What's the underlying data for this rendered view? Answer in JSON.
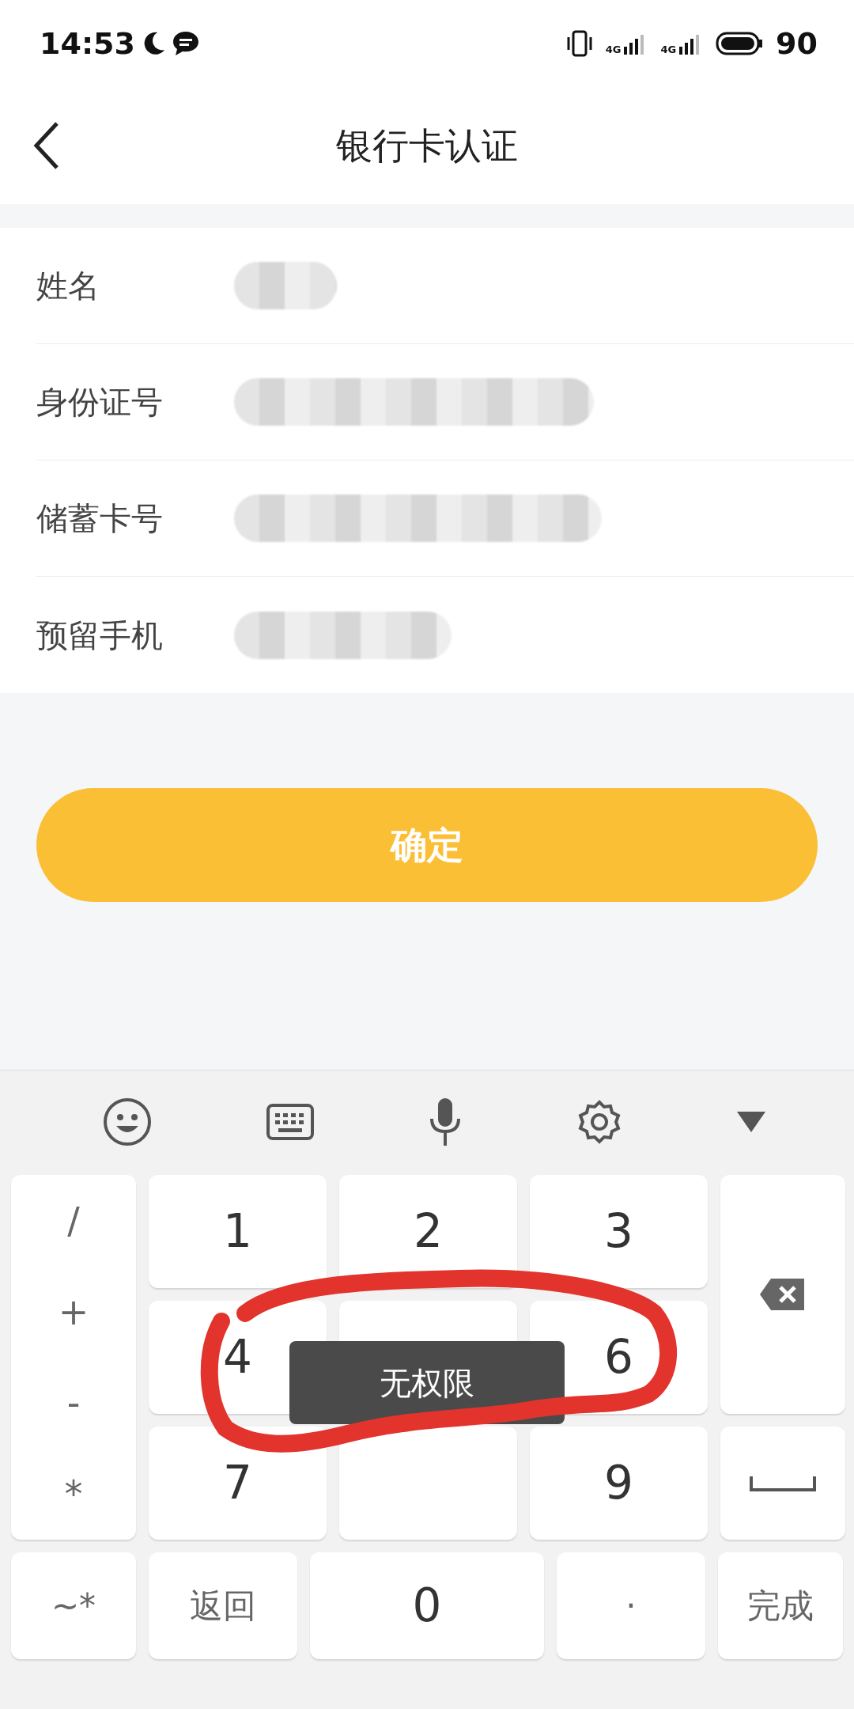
{
  "status_bar": {
    "time": "14:53",
    "network": [
      "4G",
      "4G"
    ],
    "battery": "90"
  },
  "header": {
    "title": "银行卡认证"
  },
  "fields": [
    {
      "label": "姓名",
      "value_redacted": true
    },
    {
      "label": "身份证号",
      "value_redacted": true
    },
    {
      "label": "储蓄卡号",
      "value_redacted": true
    },
    {
      "label": "预留手机",
      "value_redacted": true
    }
  ],
  "confirm_button": "确定",
  "keyboard": {
    "toolbar": [
      {
        "kind": "emoji"
      },
      {
        "kind": "keyboard"
      },
      {
        "kind": "mic"
      },
      {
        "kind": "settings"
      },
      {
        "kind": "collapse"
      }
    ],
    "symbol_keys": [
      "/",
      "+",
      "-",
      "*"
    ],
    "digits": [
      {
        "kind": "digit",
        "label": "1"
      },
      {
        "kind": "digit",
        "label": "2"
      },
      {
        "kind": "digit",
        "label": "3"
      },
      {
        "kind": "digit",
        "label": "4"
      },
      {
        "kind": "covered"
      },
      {
        "kind": "digit",
        "label": "6"
      },
      {
        "kind": "digit",
        "label": "7"
      },
      {
        "kind": "covered"
      },
      {
        "kind": "digit",
        "label": "9"
      }
    ],
    "bottom_keys": [
      "~*",
      "返回",
      "0",
      "·",
      "完成"
    ]
  },
  "toast": "无权限",
  "annotation": {
    "kind": "freehand-loop",
    "color": "#e2332d"
  }
}
